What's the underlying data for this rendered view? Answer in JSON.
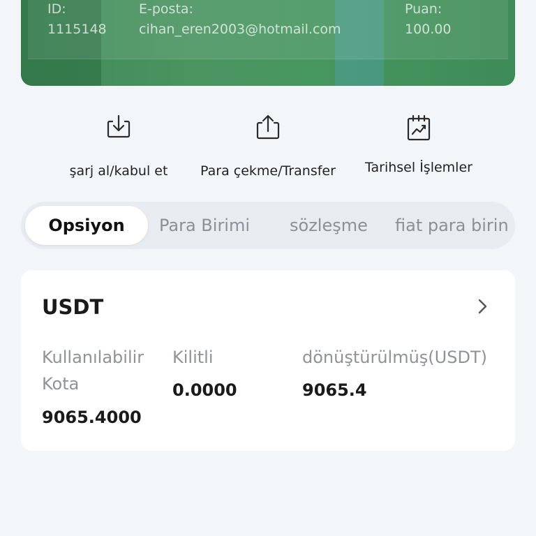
{
  "account": {
    "id_label": "ID:",
    "id_value": "1115148",
    "email_label": "E-posta:",
    "email_value": "cihan_eren2003@hotmail.com",
    "points_label": "Puan:",
    "points_value": "100.00"
  },
  "actions": [
    {
      "label": "şarj al/kabul et",
      "icon": "download-tray-icon"
    },
    {
      "label": "Para çekme/Transfer",
      "icon": "upload-share-icon"
    },
    {
      "label": "Tarihsel İşlemler",
      "icon": "chart-calendar-icon"
    }
  ],
  "tabs": [
    {
      "label": "Opsiyon",
      "active": true
    },
    {
      "label": "Para Birimi",
      "active": false
    },
    {
      "label": "sözleşme",
      "active": false
    },
    {
      "label": "fiat para birin",
      "active": false
    }
  ],
  "asset": {
    "name": "USDT",
    "available_label": "Kullanılabilir Kota",
    "available_value": "9065.4000",
    "locked_label": "Kilitli",
    "locked_value": "0.0000",
    "converted_label": "dönüştürülmüş(USDT)",
    "converted_value": "9065.4"
  },
  "colors": {
    "card_green": "#46965f",
    "background": "#f3f6f8",
    "tab_track": "#e8ecf0",
    "text_muted": "#8f9296"
  }
}
